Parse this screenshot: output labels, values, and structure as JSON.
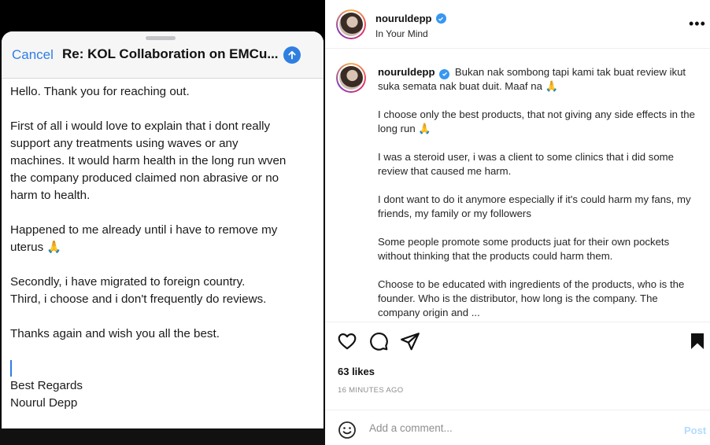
{
  "email": {
    "cancel_label": "Cancel",
    "subject": "Re: KOL Collaboration on EMCu...",
    "paragraphs": [
      "Hello. Thank you for reaching out.",
      "First of all i would love to explain that i dont really\nsupport any treatments using waves or any\nmachines. It would harm health in the long run wven\nthe company produced claimed non abrasive or no\nharm to health.",
      "Happened to me already until i have to remove my\nuterus 🙏",
      "Secondly, i have migrated to foreign country.\nThird, i choose and i don't frequently do reviews.",
      "Thanks again and wish you all the best."
    ],
    "signoff": "Best Regards",
    "signature": "Nourul Depp"
  },
  "post": {
    "username": "nouruldepp",
    "location": "In Your Mind",
    "more_label": "•••",
    "caption_first": "Bukan nak sombong tapi kami tak buat review ikut suka semata nak buat duit. Maaf na 🙏",
    "caption_paragraphs": [
      "I choose only the best products, that not giving any side effects in the long run 🙏",
      "I was a steroid user, i was a client to some clinics that i did some review that caused me harm.",
      "I dont want to do it anymore especially if it's could harm my fans, my friends, my family or my followers",
      "Some people promote some products juat for their own pockets without thinking that the products could harm them.",
      "Choose to be educated with ingredients of the products, who is the founder. Who is the distributor, how long is the company. The company origin and ..."
    ],
    "likes": "63 likes",
    "time": "16 MINUTES AGO",
    "comment_placeholder": "Add a comment...",
    "post_label": "Post"
  },
  "colors": {
    "ios_blue": "#2f7fe0",
    "verified_blue": "#3897f0",
    "post_disabled": "#b3dbff"
  }
}
